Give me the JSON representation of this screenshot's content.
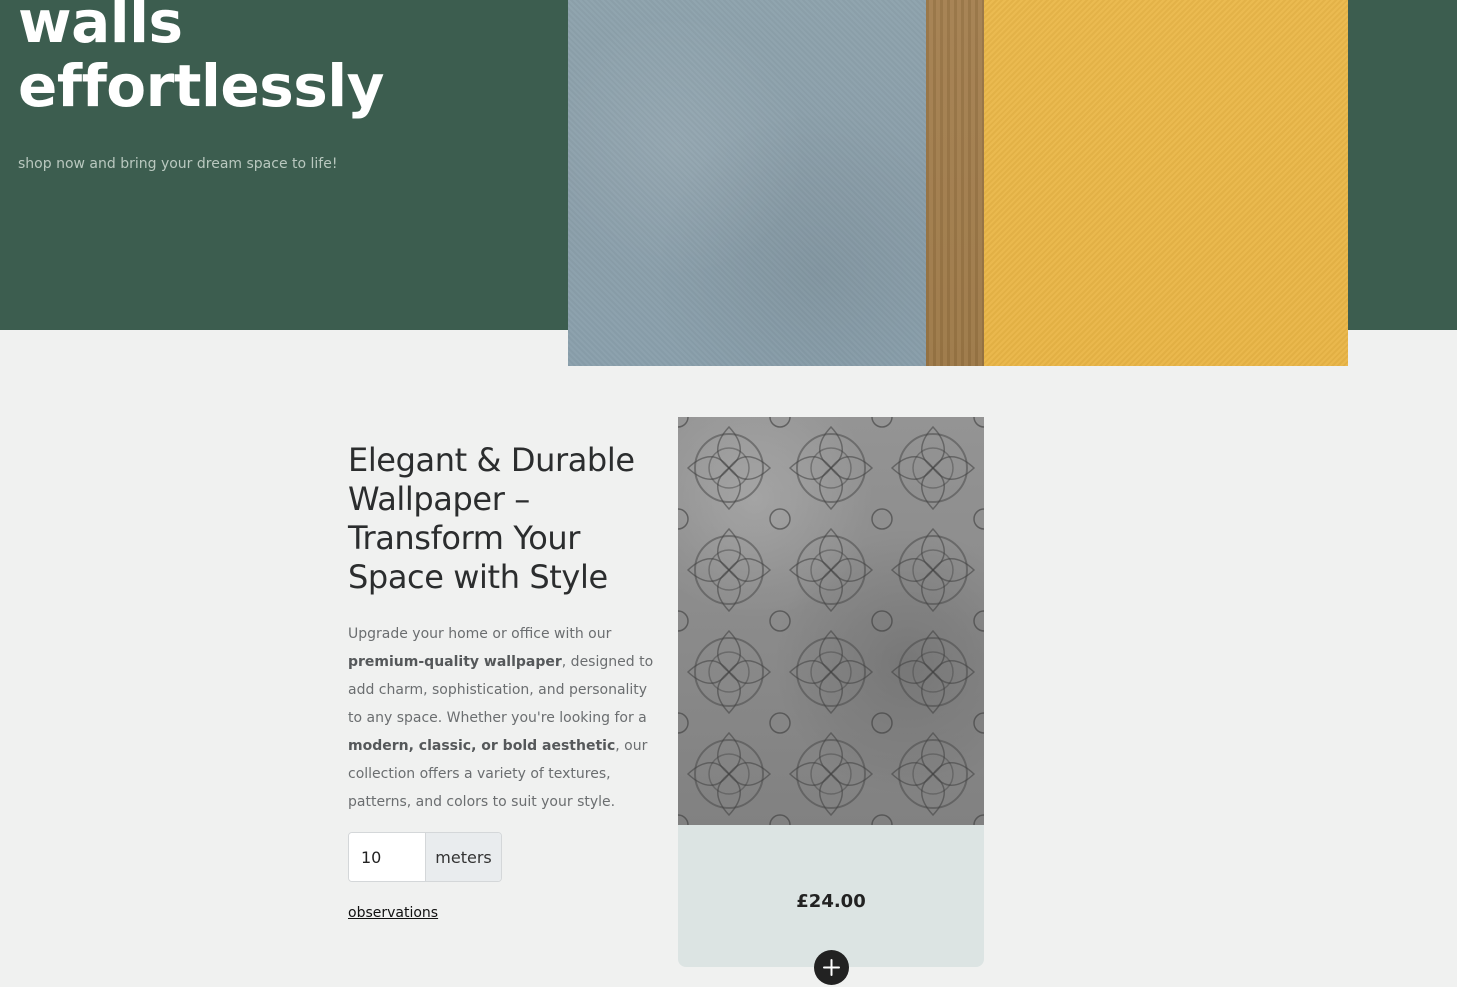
{
  "hero": {
    "title_line1": "walls",
    "title_line2": "effortlessly",
    "subtitle": "shop now and bring your dream space to life!"
  },
  "product": {
    "heading": "Elegant & Durable Wallpaper – Transform Your Space with Style",
    "description": {
      "p1": "Upgrade your home or office with our ",
      "b1": "premium-quality wallpaper",
      "p2": ", designed to add charm, sophistication, and personality to any space. Whether you're looking for a ",
      "b2": "modern, classic, or bold aesthetic",
      "p3": ", our collection offers a variety of textures, patterns, and colors to suit your style."
    },
    "quantity": {
      "value": "10",
      "unit": "meters"
    },
    "observations_link": "observations"
  },
  "card": {
    "price": "£24.00",
    "add_icon": "plus-icon"
  },
  "colors": {
    "hero_bg": "#3c5d4f",
    "page_bg": "#f0f1f0",
    "card_bg": "#dce4e3",
    "wall_blue": "#8ea3ad",
    "wall_brown": "#a47f4f",
    "wall_yellow": "#eab84a"
  }
}
